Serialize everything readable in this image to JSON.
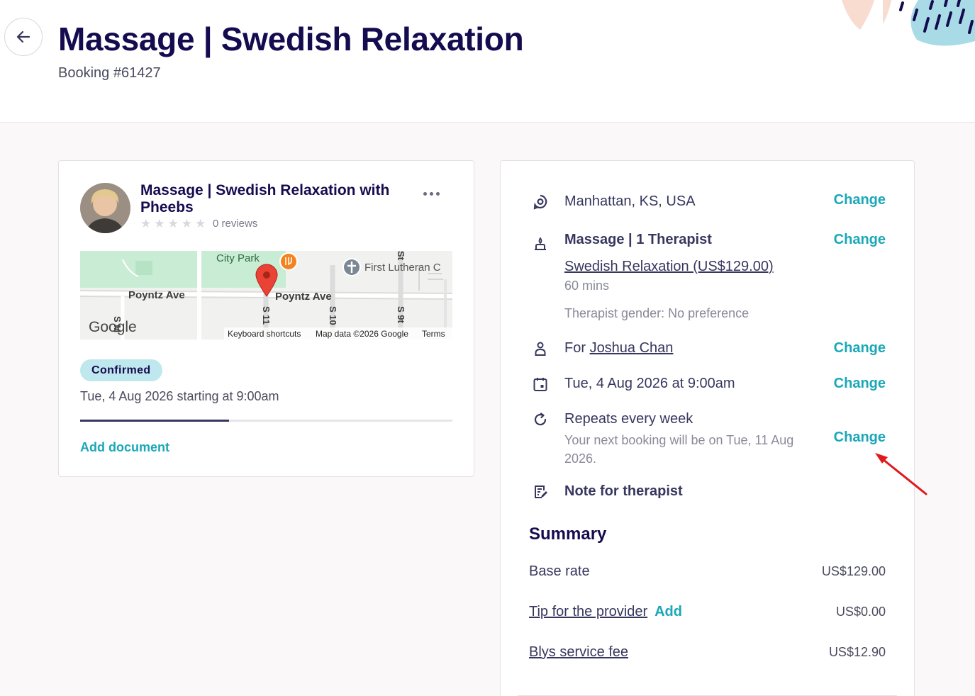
{
  "header": {
    "title": "Massage | Swedish Relaxation",
    "booking_number": "Booking #61427"
  },
  "provider_card": {
    "title": "Massage | Swedish Relaxation with Pheebs",
    "rating_stars": 0,
    "reviews": "0 reviews",
    "map": {
      "labels": {
        "city_park": "City Park",
        "poyntz_left": "Poyntz Ave",
        "poyntz_right": "Poyntz Ave",
        "church": "First Lutheran C",
        "s_m": "S M",
        "s_11": "S 11",
        "s_10": "S 10",
        "s_9": "S 9t",
        "st": "St"
      },
      "logo": "Google",
      "footer": {
        "shortcuts": "Keyboard shortcuts",
        "data": "Map data ©2026 Google",
        "terms": "Terms"
      }
    },
    "status": "Confirmed",
    "start": "Tue, 4 Aug 2026 starting at 9:00am",
    "progress": 0.4,
    "add_document": "Add document"
  },
  "details": {
    "location": {
      "text": "Manhattan, KS, USA",
      "action": "Change"
    },
    "service": {
      "text": "Massage | 1 Therapist",
      "link": "Swedish Relaxation (US$129.00)",
      "duration": "60 mins",
      "gender": "Therapist gender: No preference",
      "action": "Change"
    },
    "recipient": {
      "prefix": "For ",
      "name": "Joshua Chan",
      "action": "Change"
    },
    "date": {
      "text": "Tue, 4 Aug 2026 at 9:00am",
      "action": "Change"
    },
    "recurring": {
      "text": "Repeats every week",
      "sub": "Your next booking will be on Tue, 11 Aug 2026.",
      "action": "Change"
    },
    "note": {
      "text": "Note for therapist"
    }
  },
  "summary": {
    "title": "Summary",
    "base_rate": {
      "label": "Base rate",
      "amount": "US$129.00"
    },
    "tip": {
      "label": "Tip for the provider",
      "action": "Add",
      "amount": "US$0.00"
    },
    "service_fee": {
      "label": "Blys service fee",
      "amount": "US$12.90"
    }
  },
  "colors": {
    "title": "#150b4f",
    "accent": "#1aa7b8",
    "badge_bg": "#bfe7ee",
    "annotation": "#e0191a"
  }
}
